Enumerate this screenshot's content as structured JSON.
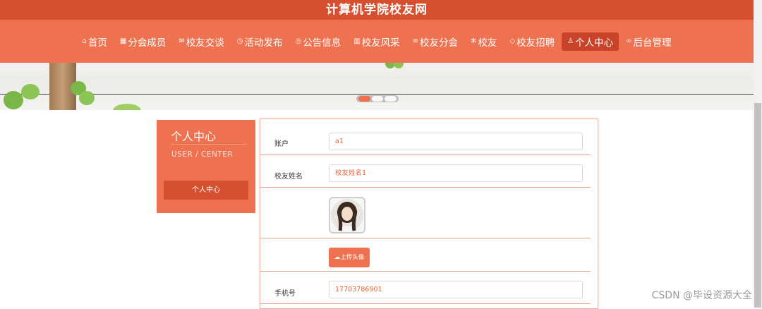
{
  "site": {
    "title": "计算机学院校友网"
  },
  "nav": {
    "items": [
      {
        "label": "首页",
        "icon": "home-icon",
        "glyph": "⌂"
      },
      {
        "label": "分会成员",
        "icon": "members-icon",
        "glyph": "▦"
      },
      {
        "label": "校友交谈",
        "icon": "mail-icon",
        "glyph": "✉"
      },
      {
        "label": "活动发布",
        "icon": "clock-icon",
        "glyph": "◷"
      },
      {
        "label": "公告信息",
        "icon": "notice-icon",
        "glyph": "◎"
      },
      {
        "label": "校友风采",
        "icon": "gallery-icon",
        "glyph": "▥"
      },
      {
        "label": "校友分会",
        "icon": "branch-icon",
        "glyph": "≡"
      },
      {
        "label": "校友",
        "icon": "star-icon",
        "glyph": "✻"
      },
      {
        "label": "校友招聘",
        "icon": "tag-icon",
        "glyph": "◇"
      },
      {
        "label": "个人中心",
        "icon": "user-icon",
        "glyph": "♙"
      },
      {
        "label": "后台管理",
        "icon": "link-icon",
        "glyph": "∞"
      }
    ],
    "active_index": 9
  },
  "colors": {
    "primary": "#ee7150",
    "dark": "#d6502f"
  },
  "sidebar": {
    "title": "个人中心",
    "subtitle": "USER / CENTER",
    "menu_button": "个人中心"
  },
  "form": {
    "account_label": "账户",
    "account_value": "a1",
    "name_label": "校友姓名",
    "name_placeholder": "校友姓名1",
    "upload_label": "上传头像",
    "phone_label": "手机号",
    "phone_value": "17703786901"
  },
  "watermark": "CSDN @毕设资源大全"
}
